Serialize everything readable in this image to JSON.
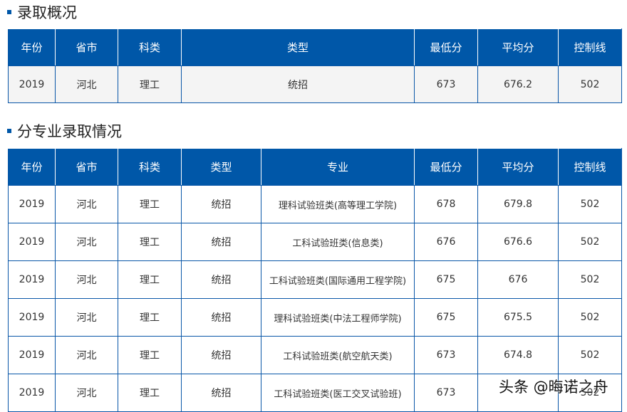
{
  "section1": {
    "title": "录取概况",
    "headers": [
      "年份",
      "省市",
      "科类",
      "类型",
      "最低分",
      "平均分",
      "控制线"
    ],
    "rows": [
      [
        "2019",
        "河北",
        "理工",
        "统招",
        "673",
        "676.2",
        "502"
      ]
    ]
  },
  "section2": {
    "title": "分专业录取情况",
    "headers": [
      "年份",
      "省市",
      "科类",
      "类型",
      "专业",
      "最低分",
      "平均分",
      "控制线"
    ],
    "rows": [
      [
        "2019",
        "河北",
        "理工",
        "统招",
        "理科试验班类(高等理工学院)",
        "678",
        "679.8",
        "502"
      ],
      [
        "2019",
        "河北",
        "理工",
        "统招",
        "工科试验班类(信息类)",
        "676",
        "676.6",
        "502"
      ],
      [
        "2019",
        "河北",
        "理工",
        "统招",
        "工科试验班类(国际通用工程学院)",
        "675",
        "676",
        "502"
      ],
      [
        "2019",
        "河北",
        "理工",
        "统招",
        "理科试验班类(中法工程师学院)",
        "675",
        "675.5",
        "502"
      ],
      [
        "2019",
        "河北",
        "理工",
        "统招",
        "工科试验班类(航空航天类)",
        "673",
        "674.8",
        "502"
      ],
      [
        "2019",
        "河北",
        "理工",
        "统招",
        "工科试验班类(医工交叉试验班)",
        "673",
        "",
        "502"
      ]
    ]
  },
  "watermark": "头条 @晦诺之舟",
  "colors": {
    "header": "#0057a8",
    "border": "#0a57a8"
  }
}
